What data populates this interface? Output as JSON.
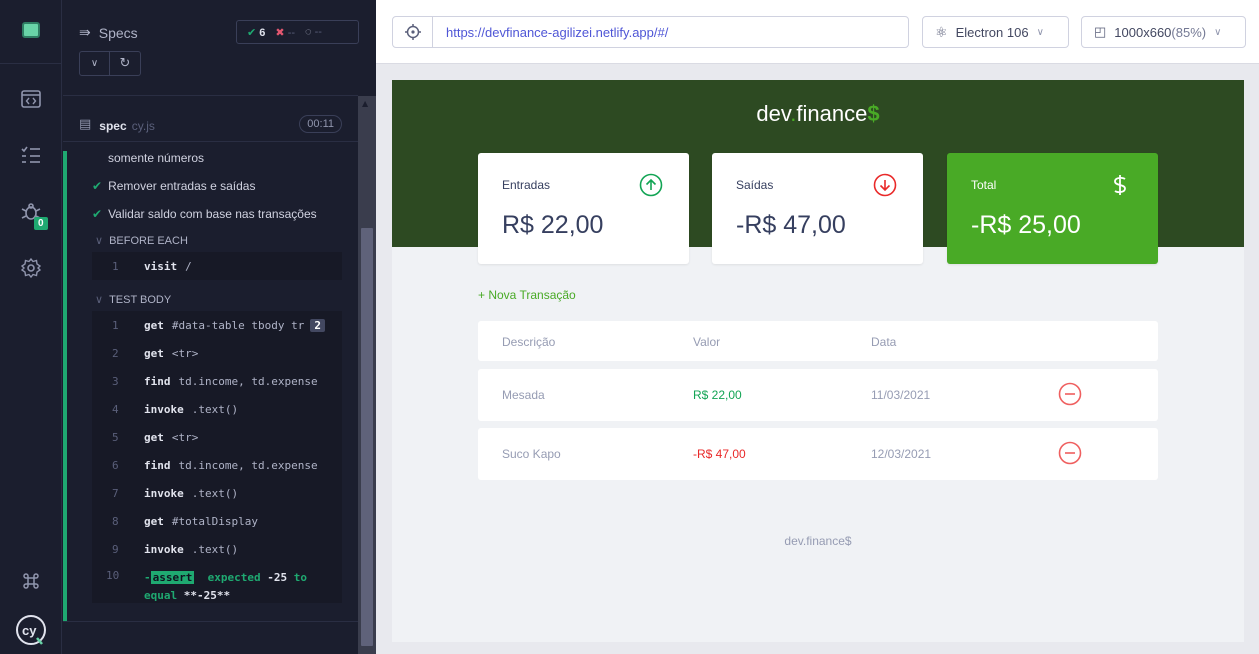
{
  "reporter": {
    "specs_label": "Specs",
    "stats": {
      "passed": "6",
      "failed": "--",
      "pending": "--"
    },
    "spec": {
      "name": "spec",
      "ext": "cy.js",
      "duration": "00:11"
    },
    "tests": [
      {
        "label": "somente números"
      },
      {
        "label": "Remover entradas e saídas"
      },
      {
        "label": "Validar saldo com base nas transações"
      }
    ],
    "before_each": {
      "title": "BEFORE EACH",
      "commands": [
        {
          "num": "1",
          "name": "visit",
          "arg": "/"
        }
      ]
    },
    "test_body": {
      "title": "TEST BODY",
      "commands": [
        {
          "num": "1",
          "name": "get",
          "arg": "#data-table tbody tr",
          "badge": "2"
        },
        {
          "num": "2",
          "name": "get",
          "arg": "<tr>"
        },
        {
          "num": "3",
          "name": "find",
          "arg": "td.income, td.expense"
        },
        {
          "num": "4",
          "name": "invoke",
          "arg": ".text()"
        },
        {
          "num": "5",
          "name": "get",
          "arg": "<tr>"
        },
        {
          "num": "6",
          "name": "find",
          "arg": "td.income, td.expense"
        },
        {
          "num": "7",
          "name": "invoke",
          "arg": ".text()"
        },
        {
          "num": "8",
          "name": "get",
          "arg": "#totalDisplay"
        },
        {
          "num": "9",
          "name": "invoke",
          "arg": ".text()"
        }
      ],
      "assert": {
        "num": "10",
        "prefix": "-",
        "tag": "assert",
        "text1": "expected",
        "val1": "-25",
        "text2": "to equal",
        "val2": "**-25**"
      }
    }
  },
  "nav": {
    "debug_badge": "0"
  },
  "browser_bar": {
    "url": "https://devfinance-agilizei.netlify.app/#/",
    "browser": "Electron 106",
    "viewport": "1000x660",
    "scale": "(85%)"
  },
  "app": {
    "logo": {
      "a": "dev",
      "dot": ".",
      "b": "finance",
      "dollar": "$"
    },
    "cards": {
      "income": {
        "label": "Entradas",
        "value": "R$ 22,00"
      },
      "expense": {
        "label": "Saídas",
        "value": "-R$ 47,00"
      },
      "total": {
        "label": "Total",
        "value": "-R$ 25,00"
      }
    },
    "new_transaction": "+ Nova Transação",
    "table": {
      "headers": [
        "Descrição",
        "Valor",
        "Data"
      ],
      "rows": [
        {
          "desc": "Mesada",
          "value": "R$ 22,00",
          "date": "11/03/2021"
        },
        {
          "desc": "Suco Kapo",
          "value": "-R$ 47,00",
          "date": "12/03/2021"
        }
      ]
    },
    "footer": "dev.finance$"
  }
}
